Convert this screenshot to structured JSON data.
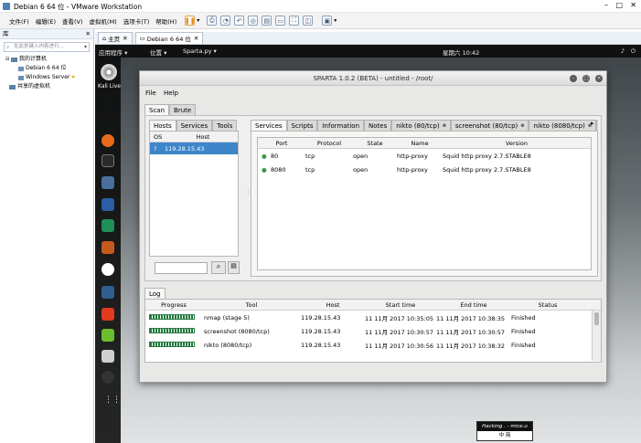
{
  "window": {
    "title": "Debian 6 64 位 - VMware Workstation"
  },
  "menu": [
    "文件(F)",
    "编辑(E)",
    "查看(V)",
    "虚拟机(M)",
    "选项卡(T)",
    "帮助(H)"
  ],
  "library": {
    "header": "库",
    "search_placeholder": "在此处键入内容进行...",
    "items": [
      "我的计算机",
      "Debian 6 64 位",
      "Windows Server",
      "共享的虚拟机"
    ]
  },
  "vm_tabs": [
    "主页",
    "Debian 6 64 位"
  ],
  "guest": {
    "topbar": {
      "apps": "应用程序 ▾",
      "places": "位置 ▾",
      "app": "Sparta.py ▾",
      "clock": "星期六 10:42"
    },
    "kali_label": "Kali Live"
  },
  "sparta": {
    "title": "SPARTA 1.0.2 (BETA) - untitled - /root/",
    "menu": [
      "File",
      "Help"
    ],
    "main_tabs": [
      "Scan",
      "Brute"
    ],
    "left_tabs": [
      "Hosts",
      "Services",
      "Tools"
    ],
    "hosts_headers": [
      "OS",
      "Host"
    ],
    "hosts": [
      {
        "os": "?",
        "host": "119.28.15.43"
      }
    ],
    "right_tabs": [
      "Services",
      "Scripts",
      "Information",
      "Notes",
      "nikto (80/tcp)",
      "screenshot (80/tcp)",
      "nikto (8080/tcp)",
      "scr"
    ],
    "services_headers": [
      "Port",
      "Protocol",
      "State",
      "Name",
      "Version"
    ],
    "services": [
      {
        "port": "80",
        "protocol": "tcp",
        "state": "open",
        "name": "http-proxy",
        "version": "Squid http proxy 2.7.STABLE8"
      },
      {
        "port": "8080",
        "protocol": "tcp",
        "state": "open",
        "name": "http-proxy",
        "version": "Squid http proxy 2.7.STABLE8"
      }
    ],
    "log_tab": "Log",
    "log_headers": [
      "Progress",
      "Tool",
      "Host",
      "Start time",
      "End time",
      "Status"
    ],
    "log_rows": [
      {
        "progress": 100,
        "tool": "nmap (stage 5)",
        "host": "119.28.15.43",
        "start": "11 11月 2017 10:35:05",
        "end": "11 11月 2017 10:38:35",
        "status": "Finished"
      },
      {
        "progress": 100,
        "tool": "screenshot (8080/tcp)",
        "host": "119.28.15.43",
        "start": "11 11月 2017 10:30:57",
        "end": "11 11月 2017 10:30:57",
        "status": "Finished"
      },
      {
        "progress": 100,
        "tool": "nikto (8080/tcp)",
        "host": "119.28.15.43",
        "start": "11 11月 2017 10:30:56",
        "end": "11 11月 2017 10:38:32",
        "status": "Finished"
      }
    ]
  },
  "watermark": {
    "line1": "Hacking . - mice.u",
    "line2": "中 简"
  },
  "colors": {
    "selection": "#3d86c9",
    "status_green": "#3c9a45",
    "desktop": "#6b7174"
  }
}
